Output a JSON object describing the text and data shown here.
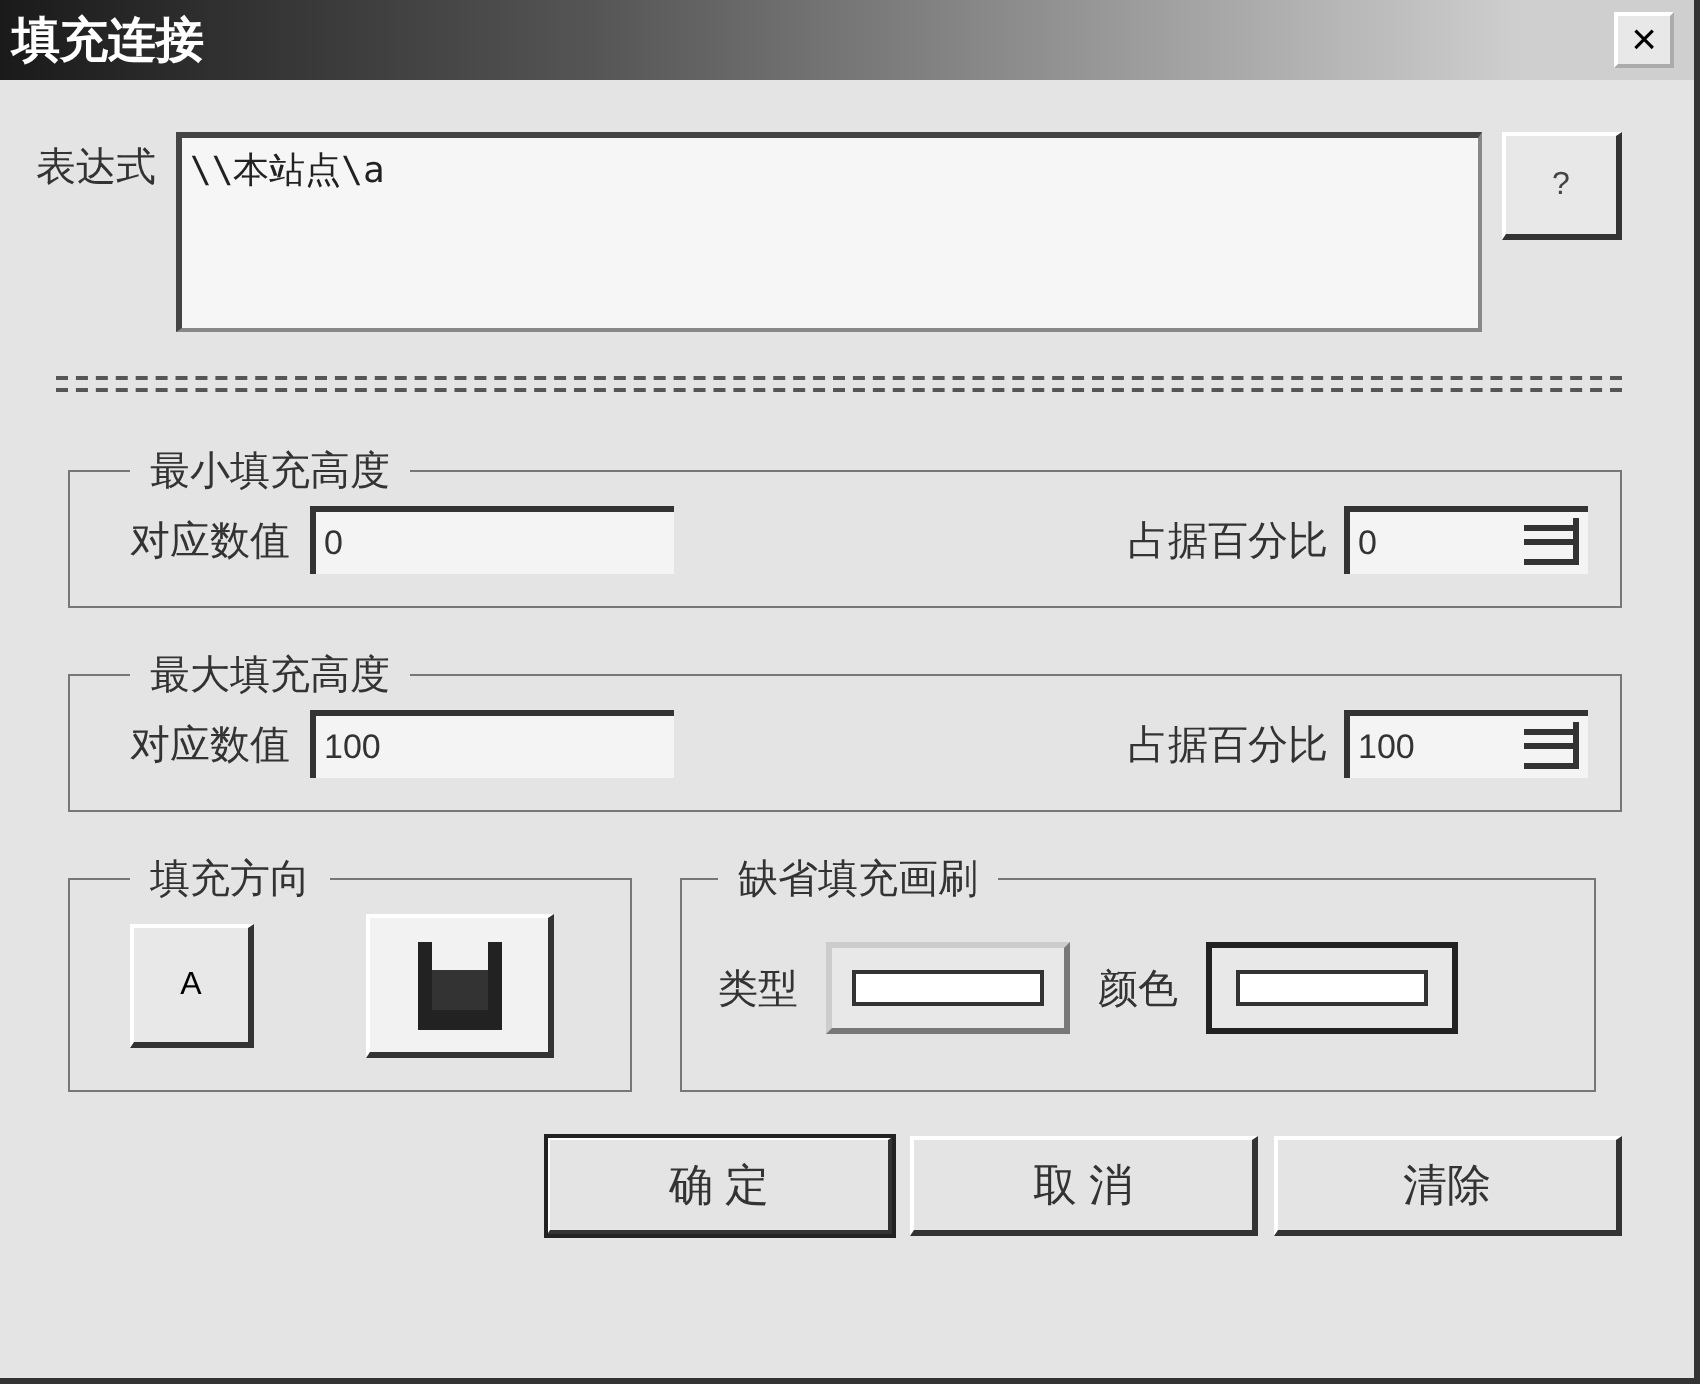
{
  "window": {
    "title": "填充连接",
    "close": "×"
  },
  "expression": {
    "label": "表达式",
    "value": "\\\\本站点\\a",
    "help": "?"
  },
  "groups": [
    {
      "title": "最小填充高度",
      "value_label": "对应数值",
      "value": "0",
      "percent_label": "占据百分比",
      "percent": "0"
    },
    {
      "title": "最大填充高度",
      "value_label": "对应数值",
      "value": "100",
      "percent_label": "占据百分比",
      "percent": "100"
    }
  ],
  "direction": {
    "title": "填充方向",
    "text_button": "A"
  },
  "brush": {
    "title": "缺省填充画刷",
    "type_label": "类型",
    "color_label": "颜色"
  },
  "buttons": [
    {
      "label": "确 定",
      "default": true
    },
    {
      "label": "取 消",
      "default": false
    },
    {
      "label": "清除",
      "default": false
    }
  ]
}
